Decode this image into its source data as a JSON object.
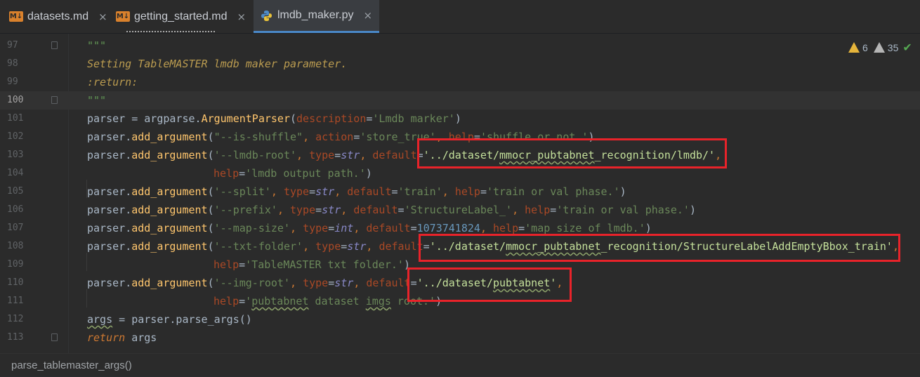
{
  "tabs": [
    {
      "label": "datasets.md",
      "icon": "markdown-icon",
      "icon_text": "M↓",
      "active": false
    },
    {
      "label": "getting_started.md",
      "icon": "markdown-icon",
      "icon_text": "M↓",
      "active": false
    },
    {
      "label": "lmdb_maker.py",
      "icon": "python-icon",
      "active": true
    }
  ],
  "close_glyph": "×",
  "inspections": {
    "warnings": "6",
    "weak_warnings": "35",
    "ok_glyph": "✔"
  },
  "lines": {
    "n97": "97",
    "n98": "98",
    "n99": "99",
    "n100": "100",
    "n101": "101",
    "n102": "102",
    "n103": "103",
    "n104": "104",
    "n105": "105",
    "n106": "106",
    "n107": "107",
    "n108": "108",
    "n109": "109",
    "n110": "110",
    "n111": "111",
    "n112": "112",
    "n113": "113"
  },
  "code": {
    "l97": "\"\"\"",
    "l98": "Setting TableMASTER lmdb maker parameter.",
    "l99": ":return:",
    "l100": "\"\"\"",
    "l101": {
      "a": "parser",
      "b": " = argparse.",
      "c": "ArgumentParser",
      "d": "(",
      "e": "description",
      "f": "=",
      "g": "'Lmdb marker'",
      "h": ")"
    },
    "l102": {
      "a": "parser",
      "b": ".",
      "c": "add_argument",
      "d": "(",
      "e": "\"--is-shuffle\"",
      "f": ", ",
      "g": "action",
      "h": "=",
      "i": "'store_true'",
      "j": ", ",
      "k": "help",
      "l": "=",
      "m": "'shuffle or not.'",
      "n": ")"
    },
    "l103": {
      "a": "parser",
      "b": ".",
      "c": "add_argument",
      "d": "(",
      "e": "'--lmdb-root'",
      "f": ", ",
      "g": "type",
      "h": "=",
      "i": "str",
      "j": ", ",
      "k": "default",
      "l": "=",
      "m1": "'../dataset/",
      "m2": "mmocr_pubtabnet",
      "m3": "_recognition/lmdb/'",
      "n": ","
    },
    "l104": {
      "a": "help",
      "b": "=",
      "c": "'lmdb output path.'",
      "d": ")"
    },
    "l105": {
      "a": "parser",
      "b": ".",
      "c": "add_argument",
      "d": "(",
      "e": "'--split'",
      "f": ", ",
      "g": "type",
      "h": "=",
      "i": "str",
      "j": ", ",
      "k": "default",
      "l": "=",
      "m": "'train'",
      "n": ", ",
      "o": "help",
      "p": "=",
      "q": "'train or val phase.'",
      "r": ")"
    },
    "l106": {
      "a": "parser",
      "b": ".",
      "c": "add_argument",
      "d": "(",
      "e": "'--prefix'",
      "f": ", ",
      "g": "type",
      "h": "=",
      "i": "str",
      "j": ", ",
      "k": "default",
      "l": "=",
      "m": "'StructureLabel_'",
      "n": ", ",
      "o": "help",
      "p": "=",
      "q": "'train or val phase.'",
      "r": ")"
    },
    "l107": {
      "a": "parser",
      "b": ".",
      "c": "add_argument",
      "d": "(",
      "e": "'--map-size'",
      "f": ", ",
      "g": "type",
      "h": "=",
      "i": "int",
      "j": ", ",
      "k": "default",
      "l": "=",
      "m": "1073741824",
      "n": ", ",
      "o": "help",
      "p": "=",
      "q": "'map size of lmdb.'",
      "r": ")"
    },
    "l108": {
      "a": "parser",
      "b": ".",
      "c": "add_argument",
      "d": "(",
      "e": "'--txt-folder'",
      "f": ", ",
      "g": "type",
      "h": "=",
      "i": "str",
      "j": ", ",
      "k": "default",
      "l": "=",
      "m1": "'../dataset/",
      "m2": "mmocr_pubtabnet",
      "m3": "_recognition/StructureLabelAddEmptyBbox_train'",
      "n": ","
    },
    "l109": {
      "a": "help",
      "b": "=",
      "c": "'TableMASTER txt folder.'",
      "d": ")"
    },
    "l110": {
      "a": "parser",
      "b": ".",
      "c": "add_argument",
      "d": "(",
      "e": "'--img-root'",
      "f": ", ",
      "g": "type",
      "h": "=",
      "i": "str",
      "j": ", ",
      "k": "default",
      "l": "=",
      "m1": "'../dataset/",
      "m2": "pubtabnet",
      "m3": "'",
      "n": ","
    },
    "l111": {
      "a": "help",
      "b": "=",
      "c1": "'",
      "c2": "pubtabnet",
      "c3": " dataset ",
      "c4": "imgs",
      "c5": " root.'",
      "d": ")"
    },
    "l112": {
      "a": "args",
      "b": " = ",
      "c": "parser",
      "d": ".parse_args()"
    },
    "l113": {
      "a": "return",
      "b": " args"
    }
  },
  "statusbar": {
    "breadcrumb": "parse_tablemaster_args()"
  },
  "colors": {
    "highlight_box": "#e8232a",
    "tab_accent": "#4a88c7"
  }
}
